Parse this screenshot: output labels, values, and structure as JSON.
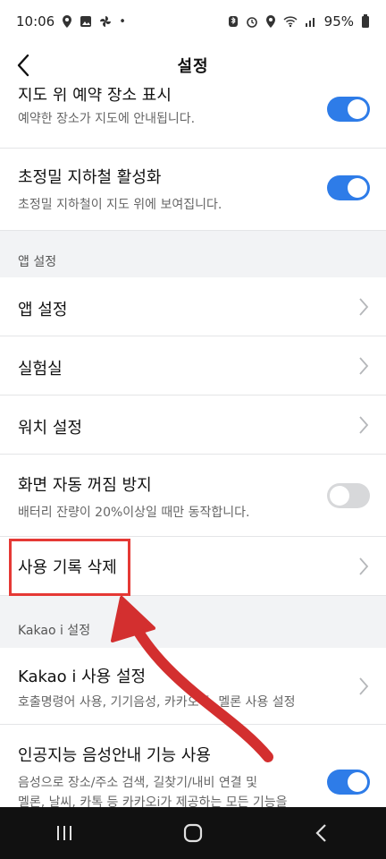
{
  "status_bar": {
    "time": "10:06",
    "left_icons": [
      "location-icon",
      "gallery-icon",
      "pinwheel-icon",
      "dot-icon"
    ],
    "right_icons": [
      "bluetooth-icon",
      "alarm-icon",
      "location-icon",
      "wifi-icon",
      "signal-icon"
    ],
    "battery": "95%"
  },
  "header": {
    "title": "설정"
  },
  "rows": {
    "map_reservation": {
      "title": "지도 위 예약 장소 표시",
      "desc": "예약한 장소가 지도에 안내됩니다.",
      "toggle": "on"
    },
    "precise_subway": {
      "title": "초정밀 지하철 활성화",
      "desc": "초정밀 지하철이 지도 위에 보여집니다.",
      "toggle": "on"
    },
    "app_settings": {
      "title": "앱 설정"
    },
    "lab": {
      "title": "실험실"
    },
    "watch_settings": {
      "title": "워치 설정"
    },
    "screen_off": {
      "title": "화면 자동 꺼짐 방지",
      "desc": "배터리 잔량이 20%이상일 때만 동작합니다.",
      "toggle": "off"
    },
    "delete_history": {
      "title": "사용 기록 삭제"
    },
    "kakao_i_use": {
      "title": "Kakao i 사용 설정",
      "desc": "호출명령어 사용, 기기음성, 카카오톡, 멜론 사용 설정"
    },
    "ai_voice": {
      "title": "인공지능 음성안내 기능 사용",
      "desc1": "음성으로 장소/주소 검색, 길찾기/내비 연결 및",
      "desc2": "멜론, 날씨, 카톡 등 카카오i가 제공하는 모든 기능을",
      "toggle": "on"
    }
  },
  "sections": {
    "app": "앱 설정",
    "kakao_i": "Kakao i 설정"
  },
  "colors": {
    "accent": "#2e7ce8",
    "highlight": "#e53935",
    "arrow": "#d32f2f"
  }
}
